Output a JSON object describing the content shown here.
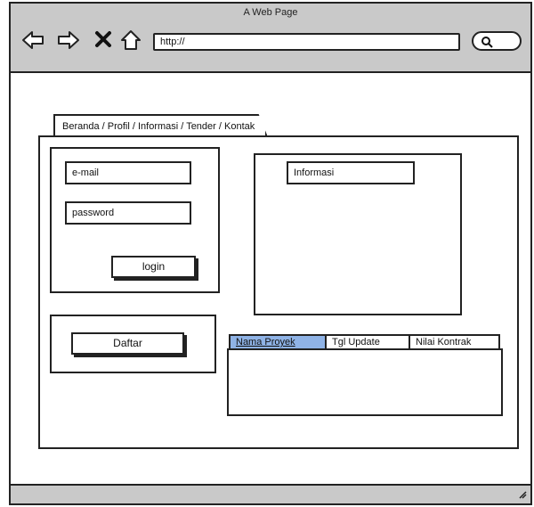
{
  "browser": {
    "title": "A Web Page",
    "url": "http://",
    "back_icon": "back-arrow-icon",
    "forward_icon": "forward-arrow-icon",
    "stop_icon": "stop-x-icon",
    "home_icon": "home-icon",
    "search_icon": "search-icon"
  },
  "nav": {
    "breadcrumb": "Beranda / Profil / Informasi / Tender / Kontak"
  },
  "login": {
    "email_placeholder": "e-mail",
    "password_placeholder": "password",
    "login_label": "login"
  },
  "register": {
    "label": "Daftar"
  },
  "info": {
    "heading": "Informasi"
  },
  "tender_table": {
    "columns": [
      "Nama Proyek",
      "Tgl Update",
      "Nilai Kontrak"
    ]
  },
  "colors": {
    "chrome": "#c9c9c9",
    "active_tab": "#8fb3e6"
  }
}
